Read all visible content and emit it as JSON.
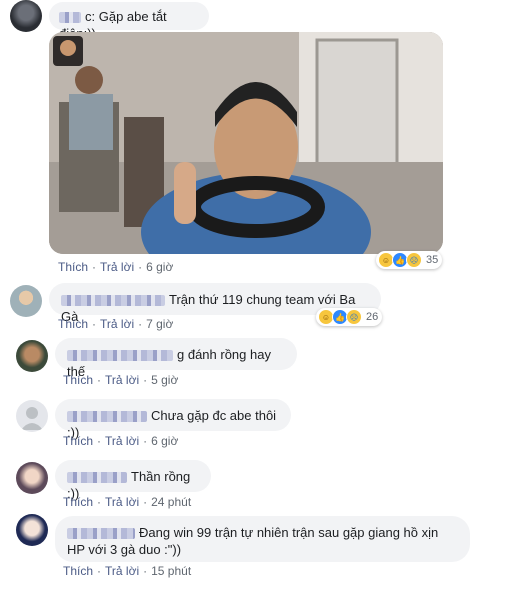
{
  "comments": [
    {
      "text": "c: Gặp abe tắt điện:))",
      "like": "Thích",
      "reply": "Trả lời",
      "time": "6 giờ",
      "reactions": "35"
    },
    {
      "text": "Trận thứ 119 chung team với Ba Gà",
      "like": "Thích",
      "reply": "Trả lời",
      "time": "7 giờ",
      "reactions": "26"
    },
    {
      "text": "g đánh rồng hay thế",
      "like": "Thích",
      "reply": "Trả lời",
      "time": "5 giờ"
    },
    {
      "text": "Chưa gặp đc abe thôi :))",
      "like": "Thích",
      "reply": "Trả lời",
      "time": "6 giờ"
    },
    {
      "text": "Thần rồng :))",
      "like": "Thích",
      "reply": "Trả lời",
      "time": "24 phút"
    },
    {
      "text": "Đang win 99 trận tự nhiên trận sau gặp giang hồ xịn HP với 3 gà duo :\"))",
      "like": "Thích",
      "reply": "Trả lời",
      "time": "15 phút"
    }
  ],
  "icons": {
    "reactions": [
      "haha-icon",
      "like-icon",
      "sad-icon"
    ]
  }
}
